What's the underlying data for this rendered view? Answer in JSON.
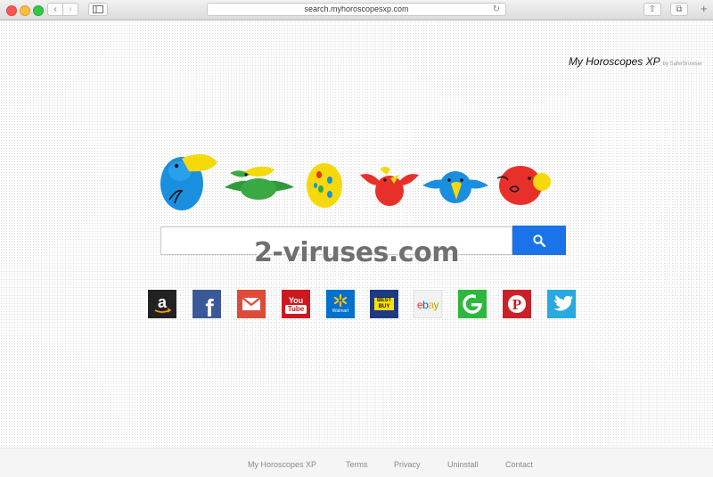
{
  "browser": {
    "url": "search.myhoroscopesxp.com",
    "back_label": "‹",
    "forward_label": "›",
    "reload_label": "↻",
    "share_label": "⇧",
    "tabs_label": "⧉",
    "new_tab_label": "+"
  },
  "brand": {
    "name": "My Horoscopes XP",
    "by": "by SaferBrowser"
  },
  "search": {
    "value": "",
    "placeholder": ""
  },
  "watermark": "2-viruses.com",
  "quick_links": [
    {
      "name": "amazon",
      "icon": "amazon-icon",
      "text": "a"
    },
    {
      "name": "facebook",
      "icon": "facebook-icon",
      "text": "f"
    },
    {
      "name": "gmail",
      "icon": "gmail-icon",
      "text": ""
    },
    {
      "name": "youtube",
      "icon": "youtube-icon",
      "text_top": "You",
      "text_bottom": "Tube"
    },
    {
      "name": "walmart",
      "icon": "walmart-icon",
      "text": "Walmart"
    },
    {
      "name": "bestbuy",
      "icon": "bestbuy-icon",
      "text": "BEST BUY"
    },
    {
      "name": "ebay",
      "icon": "ebay-icon",
      "letters": [
        "e",
        "b",
        "a",
        "y"
      ]
    },
    {
      "name": "g",
      "icon": "g-icon",
      "text": "G"
    },
    {
      "name": "pinterest",
      "icon": "pinterest-icon",
      "text": "P"
    },
    {
      "name": "twitter",
      "icon": "twitter-icon",
      "text": ""
    }
  ],
  "footer": {
    "links": [
      "My Horoscopes XP",
      "Terms",
      "Privacy",
      "Uninstall",
      "Contact"
    ]
  },
  "colors": {
    "search_button": "#1a73e8",
    "bird_blue": "#1a8fe0",
    "bird_yellow": "#f5d90a",
    "bird_green": "#3aa843",
    "bird_red": "#e8302a"
  }
}
